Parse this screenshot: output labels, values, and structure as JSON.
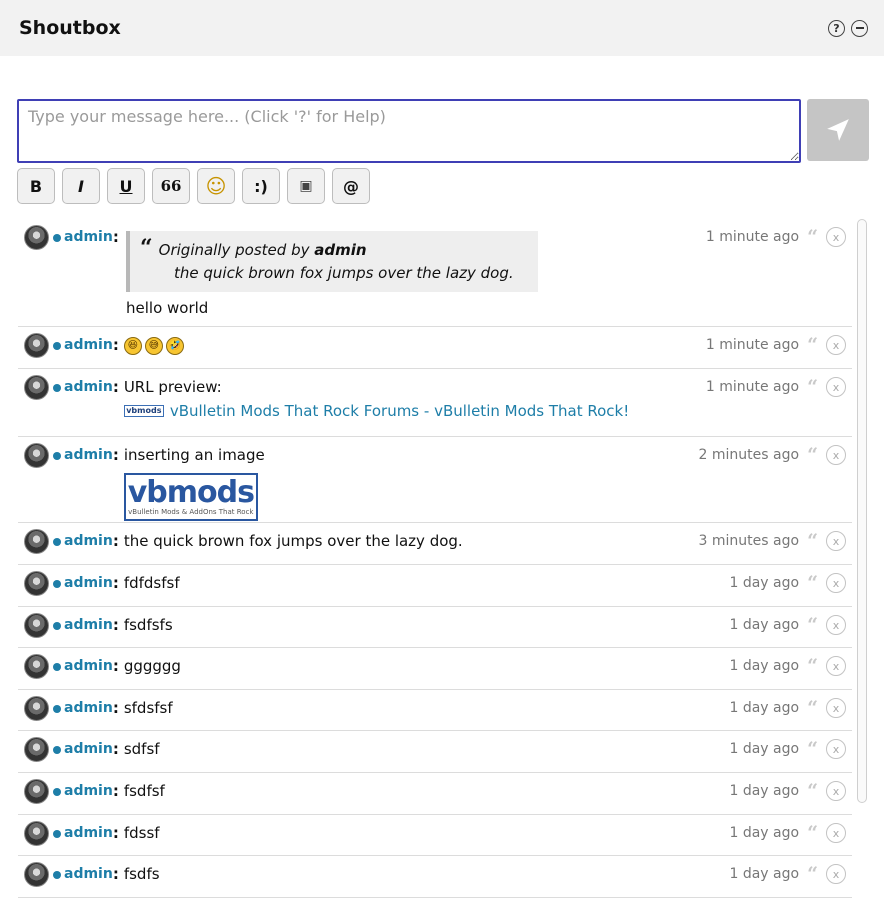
{
  "header": {
    "title": "Shoutbox",
    "help_glyph": "?"
  },
  "composer": {
    "placeholder": "Type your message here... (Click '?' for Help)",
    "toolbar": [
      {
        "name": "bold-button",
        "glyph": "B"
      },
      {
        "name": "italic-button",
        "glyph": "I"
      },
      {
        "name": "underline-button",
        "glyph": "U"
      },
      {
        "name": "quote-button",
        "glyph": "66"
      },
      {
        "name": "emoji-button",
        "glyph": "☺"
      },
      {
        "name": "smiley-button",
        "glyph": ":)"
      },
      {
        "name": "image-button",
        "glyph": "▣"
      },
      {
        "name": "mention-button",
        "glyph": "@"
      }
    ]
  },
  "messages": [
    {
      "user": "admin",
      "text": "hello world",
      "time": "1 minute ago",
      "quote": {
        "prefix": "Originally posted by",
        "author": "admin",
        "text": "the quick brown fox jumps over the lazy dog."
      }
    },
    {
      "user": "admin",
      "emojis": [
        "😆",
        "😅",
        "🤣"
      ],
      "time": "1 minute ago"
    },
    {
      "user": "admin",
      "text": "URL preview:",
      "time": "1 minute ago",
      "link": {
        "favicon_text": "vbmods",
        "text": "vBulletin Mods That Rock Forums - vBulletin Mods That Rock!"
      }
    },
    {
      "user": "admin",
      "text": "inserting an image",
      "time": "2 minutes ago",
      "image": {
        "logo": "vbmods",
        "tagline": "vBulletin Mods & AddOns That Rock"
      }
    },
    {
      "user": "admin",
      "text": "the quick brown fox jumps over the lazy dog.",
      "time": "3 minutes ago"
    },
    {
      "user": "admin",
      "text": "fdfdsfsf",
      "time": "1 day ago"
    },
    {
      "user": "admin",
      "text": "fsdfsfs",
      "time": "1 day ago"
    },
    {
      "user": "admin",
      "text": "gggggg",
      "time": "1 day ago"
    },
    {
      "user": "admin",
      "text": "sfdsfsf",
      "time": "1 day ago"
    },
    {
      "user": "admin",
      "text": "sdfsf",
      "time": "1 day ago"
    },
    {
      "user": "admin",
      "text": "fsdfsf",
      "time": "1 day ago"
    },
    {
      "user": "admin",
      "text": "fdssf",
      "time": "1 day ago"
    },
    {
      "user": "admin",
      "text": "fsdfs",
      "time": "1 day ago"
    }
  ]
}
